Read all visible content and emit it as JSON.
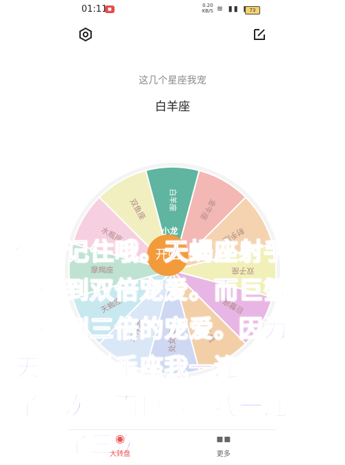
{
  "status_bar": {
    "time": "01:11",
    "net_speed_value": "0.20",
    "net_speed_unit": "KB/S",
    "battery": "73"
  },
  "main": {
    "subtitle": "这几个星座我宠",
    "result": "白羊座",
    "start_label": "开始",
    "pointer_label": "小龙"
  },
  "wheel": {
    "segments": [
      {
        "label": "白羊座",
        "color": "#5fb59f"
      },
      {
        "label": "金牛座",
        "color": "#f3b7b4"
      },
      {
        "label": "射手座",
        "color": "#f5d2b0"
      },
      {
        "label": "双子座",
        "color": "#f0f0b8"
      },
      {
        "label": "巨蟹座",
        "color": "#e8b6e4"
      },
      {
        "label": "狮子座",
        "color": "#f3cfa8"
      },
      {
        "label": "处女座",
        "color": "#cfd8f2"
      },
      {
        "label": "天秤座",
        "color": "#d9e7f6"
      },
      {
        "label": "天蝎座",
        "color": "#c8e8f0"
      },
      {
        "label": "摩羯座",
        "color": "#bfe3d2"
      },
      {
        "label": "水瓶座",
        "color": "#f6cfe0"
      },
      {
        "label": "双鱼座",
        "color": "#f1efc0"
      }
    ]
  },
  "overlay_caption": [
    "你要记住哦。天蝎座射手",
    "座得到双倍宠爱。而巨蟹",
    "座得到三倍的宠爱。因为",
    "天蝎座射手座我一连转到",
    "了两次。而巨蟹座我一连",
    "转到了三次。"
  ],
  "bottom_nav": {
    "wheel_label": "大转盘",
    "more_label": "更多"
  }
}
